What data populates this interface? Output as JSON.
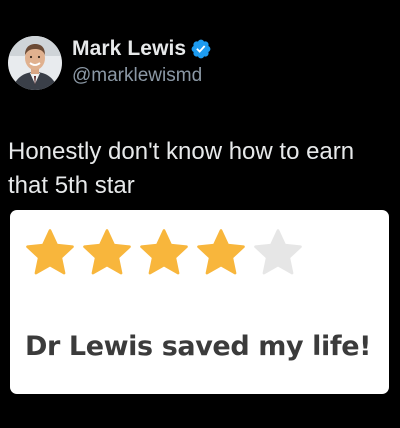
{
  "author": {
    "display_name": "Mark Lewis",
    "handle": "@marklewismd",
    "verified": true,
    "verified_color": "#1d9bf0"
  },
  "tweet": {
    "text": "Honestly don't know how to earn that 5th star"
  },
  "review_card": {
    "rating": 4,
    "max_rating": 5,
    "star_filled_color": "#f8b63c",
    "star_empty_color": "#e6e6e6",
    "review_text": "Dr Lewis saved my life!"
  },
  "icons": {
    "avatar": "avatar",
    "verified": "verified-badge-icon",
    "star": "star-icon"
  }
}
